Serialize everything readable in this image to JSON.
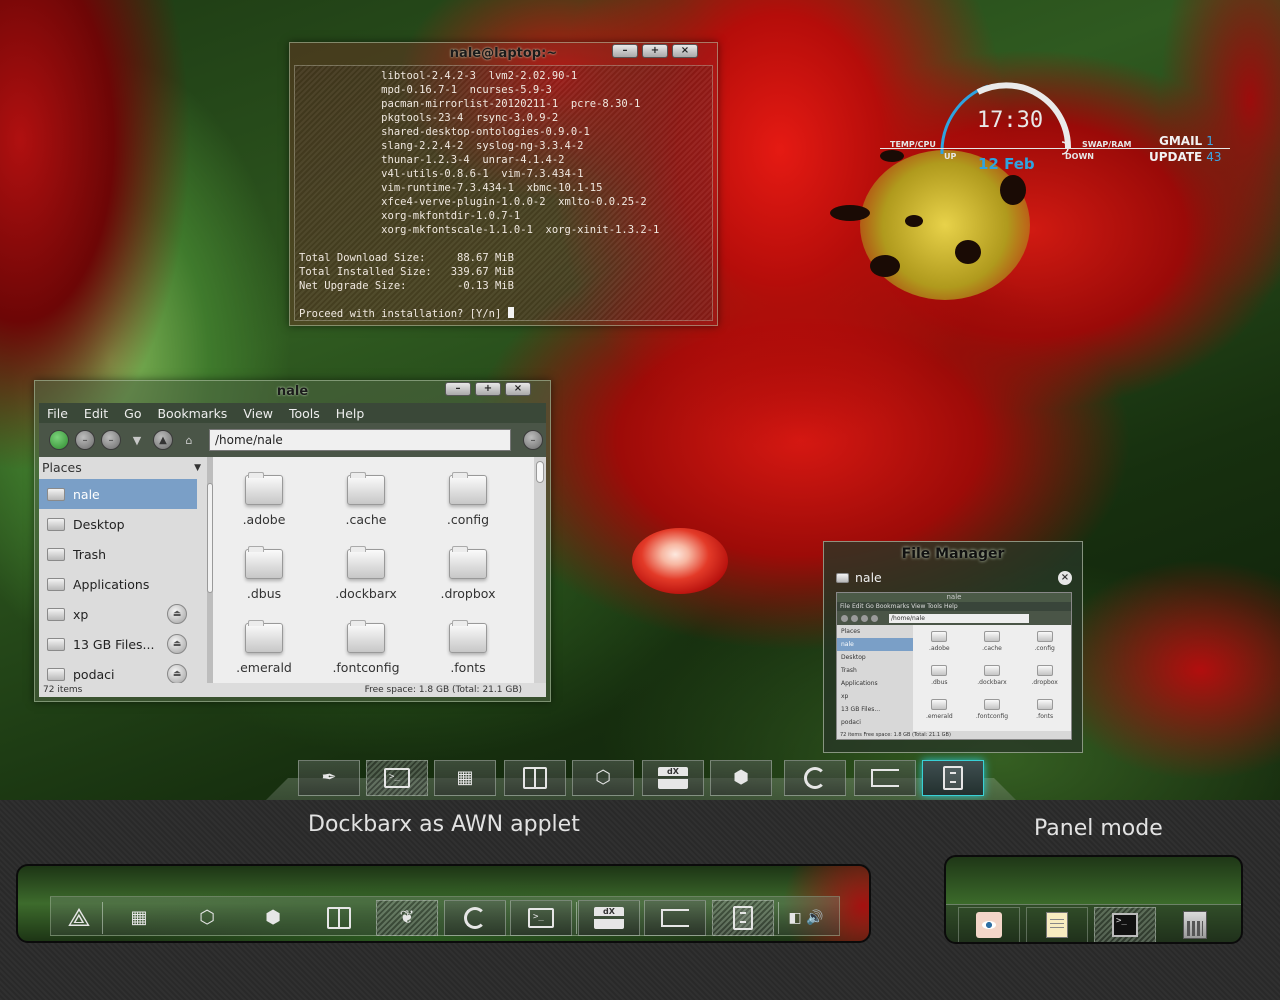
{
  "terminal": {
    "title": "nale@laptop:~",
    "buttons": {
      "minimize": "–",
      "maximize": "+",
      "close": "×"
    },
    "lines": [
      "             libtool-2.4.2-3  lvm2-2.02.90-1",
      "             mpd-0.16.7-1  ncurses-5.9-3",
      "             pacman-mirrorlist-20120211-1  pcre-8.30-1",
      "             pkgtools-23-4  rsync-3.0.9-2",
      "             shared-desktop-ontologies-0.9.0-1",
      "             slang-2.2.4-2  syslog-ng-3.3.4-2",
      "             thunar-1.2.3-4  unrar-4.1.4-2",
      "             v4l-utils-0.8.6-1  vim-7.3.434-1",
      "             vim-runtime-7.3.434-1  xbmc-10.1-15",
      "             xfce4-verve-plugin-1.0.0-2  xmlto-0.0.25-2",
      "             xorg-mkfontdir-1.0.7-1",
      "             xorg-mkfontscale-1.1.0-1  xorg-xinit-1.3.2-1",
      "",
      "Total Download Size:     88.67 MiB",
      "Total Installed Size:   339.67 MiB",
      "Net Upgrade Size:        -0.13 MiB",
      "",
      "Proceed with installation? [Y/n] "
    ]
  },
  "file_manager": {
    "title": "nale",
    "buttons": {
      "minimize": "–",
      "maximize": "+",
      "close": "×"
    },
    "menu": [
      "File",
      "Edit",
      "Go",
      "Bookmarks",
      "View",
      "Tools",
      "Help"
    ],
    "path": "/home/nale",
    "places_header": "Places",
    "places": [
      {
        "label": "nale",
        "selected": true,
        "eject": false
      },
      {
        "label": "Desktop",
        "selected": false,
        "eject": false
      },
      {
        "label": "Trash",
        "selected": false,
        "eject": false
      },
      {
        "label": "Applications",
        "selected": false,
        "eject": false
      },
      {
        "label": "xp",
        "selected": false,
        "eject": true
      },
      {
        "label": "13 GB Files...",
        "selected": false,
        "eject": true
      },
      {
        "label": "podaci",
        "selected": false,
        "eject": true
      }
    ],
    "files": [
      ".adobe",
      ".cache",
      ".config",
      ".dbus",
      ".dockbarx",
      ".dropbox",
      ".emerald",
      ".fontconfig",
      ".fonts"
    ],
    "status_left": "72 items",
    "status_right": "Free space: 1.8 GB (Total: 21.1 GB)"
  },
  "clock_widget": {
    "time": "17:30",
    "date": "12 Feb",
    "temp_cpu": "TEMP/CPU",
    "up": "UP",
    "down": "DOWN",
    "swap_ram": "SWAP/RAM",
    "gmail_label": "GMAIL",
    "gmail_count": "1",
    "update_label": "UPDATE",
    "update_count": "43",
    "accent_color": "#2fa3e0"
  },
  "preview": {
    "title": "File Manager",
    "window_name": "nale",
    "close": "×",
    "thumb_title": "nale",
    "thumb_menu": "File  Edit  Go  Bookmarks  View  Tools  Help",
    "thumb_path": "/home/nale",
    "thumb_places": [
      "Places",
      "nale",
      "Desktop",
      "Trash",
      "Applications",
      "xp",
      "13 GB Files...",
      "podaci"
    ],
    "thumb_files": [
      ".adobe",
      ".cache",
      ".config",
      ".dbus",
      ".dockbarx",
      ".dropbox",
      ".emerald",
      ".fontconfig",
      ".fonts"
    ],
    "thumb_status": "72 items                                   Free space: 1.8 GB (Total: 21.1 GB)"
  },
  "dock_top": {
    "items": [
      {
        "name": "inkscape",
        "icon": "pen-icon"
      },
      {
        "name": "terminal",
        "icon": "terminal-icon"
      },
      {
        "name": "calculator",
        "icon": "calculator-icon"
      },
      {
        "name": "book-reader",
        "icon": "book-icon"
      },
      {
        "name": "messenger",
        "icon": "chat-icon"
      },
      {
        "name": "dockbarx",
        "icon": "dx-icon",
        "text": "dX"
      },
      {
        "name": "3d-app",
        "icon": "cube-icon"
      },
      {
        "name": "firefox",
        "icon": "firefox-icon"
      },
      {
        "name": "window",
        "icon": "window-icon"
      },
      {
        "name": "file-manager",
        "icon": "cabinet-icon",
        "active": true
      }
    ],
    "active_color": "#39d0d6"
  },
  "bottom": {
    "awn_heading": "Dockbarx as AWN applet",
    "panel_heading": "Panel mode",
    "awn_dx_text": "dX",
    "panel_term_text": ">_"
  }
}
